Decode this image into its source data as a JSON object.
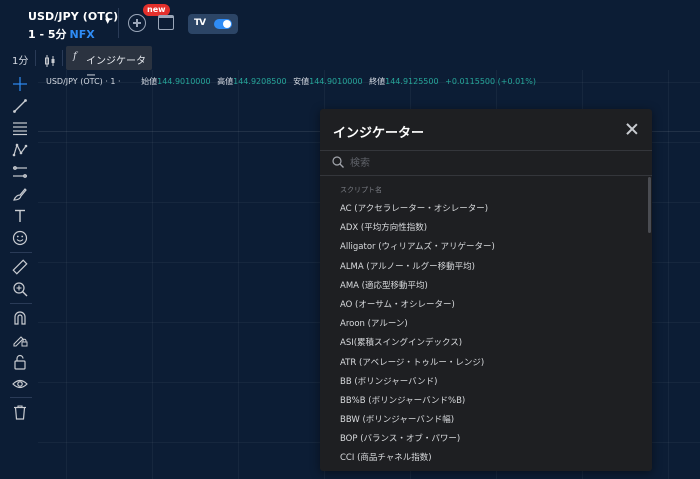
{
  "header": {
    "symbol": "USD/JPY (OTC)",
    "timeframe_range": "1 - 5分",
    "exchange": "NFX",
    "new_badge": "new",
    "tv_logo": "TV"
  },
  "toolbar": {
    "timeframe": "1分",
    "indicators_fx": "f",
    "indicators_label": "インジケーター"
  },
  "legend": {
    "title": "USD/JPY (OTC) · 1 ·",
    "open_label": "始値",
    "open_value": "144.9010000",
    "high_label": "高値",
    "high_value": "144.9208500",
    "low_label": "安値",
    "low_value": "144.9010000",
    "close_label": "終値",
    "close_value": "144.9125500",
    "change": "+0.0115500 (+0.01%)"
  },
  "modal": {
    "title": "インジケーター",
    "search_placeholder": "検索",
    "section_label": "スクリプト名",
    "items": [
      "AC (アクセラレーター・オシレーター)",
      "ADX (平均方向性指数)",
      "Alligator (ウィリアムズ・アリゲーター)",
      "ALMA (アルノー・ルグー移動平均)",
      "AMA (適応型移動平均)",
      "AO (オーサム・オシレーター)",
      "Aroon (アルーン)",
      "ASI(累積スイングインデックス)",
      "ATR (アベレージ・トゥルー・レンジ)",
      "BB (ボリンジャーバンド)",
      "BB%B (ボリンジャーバンド%B)",
      "BBW (ボリンジャーバンド幅)",
      "BOP (バランス・オブ・パワー)",
      "CCI (商品チャネル指数)"
    ]
  },
  "colors": {
    "background": "#0c1d35",
    "accent": "#2f8cf5",
    "positive": "#26a69a",
    "badge": "#e2302c",
    "modal_bg": "#1e1f22"
  },
  "left_tools": [
    "crosshair-icon",
    "trend-line-icon",
    "fib-lines-icon",
    "pattern-icon",
    "channel-icon",
    "brush-icon",
    "text-icon",
    "emoji-icon",
    "ruler-icon",
    "zoom-in-icon",
    "magnet-icon",
    "lock-drawing-icon",
    "lock-icon",
    "eye-icon",
    "trash-icon"
  ]
}
